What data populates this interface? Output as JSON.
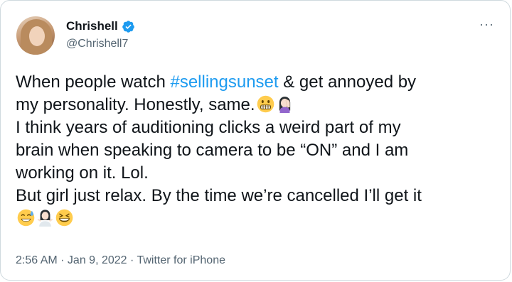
{
  "author": {
    "name": "Chrishell",
    "handle": "@Chrishell7"
  },
  "more_menu": "···",
  "tweet": {
    "part1": "When people watch ",
    "hashtag": "#sellingsunset",
    "part2": " & get annoyed by\nmy personality. Honestly, same.",
    "part3": "\nI think years of auditioning clicks a weird part of my\nbrain when speaking to camera to be “ON” and I am\nworking on it. Lol.\nBut girl just relax. By the time we’re cancelled I’ll get it\n"
  },
  "meta": {
    "time": "2:56 AM",
    "date": "Jan 9, 2022",
    "source": "Twitter for iPhone",
    "separator": " · "
  },
  "colors": {
    "link": "#1d9bf0",
    "verified": "#1d9bf0",
    "secondary_text": "#536471"
  },
  "icons": [
    "verified-badge-icon",
    "more-dots-icon",
    "grimacing-face-emoji",
    "woman-facepalming-emoji",
    "sweat-smile-emoji",
    "woman-shrugging-emoji",
    "laughing-face-emoji"
  ]
}
